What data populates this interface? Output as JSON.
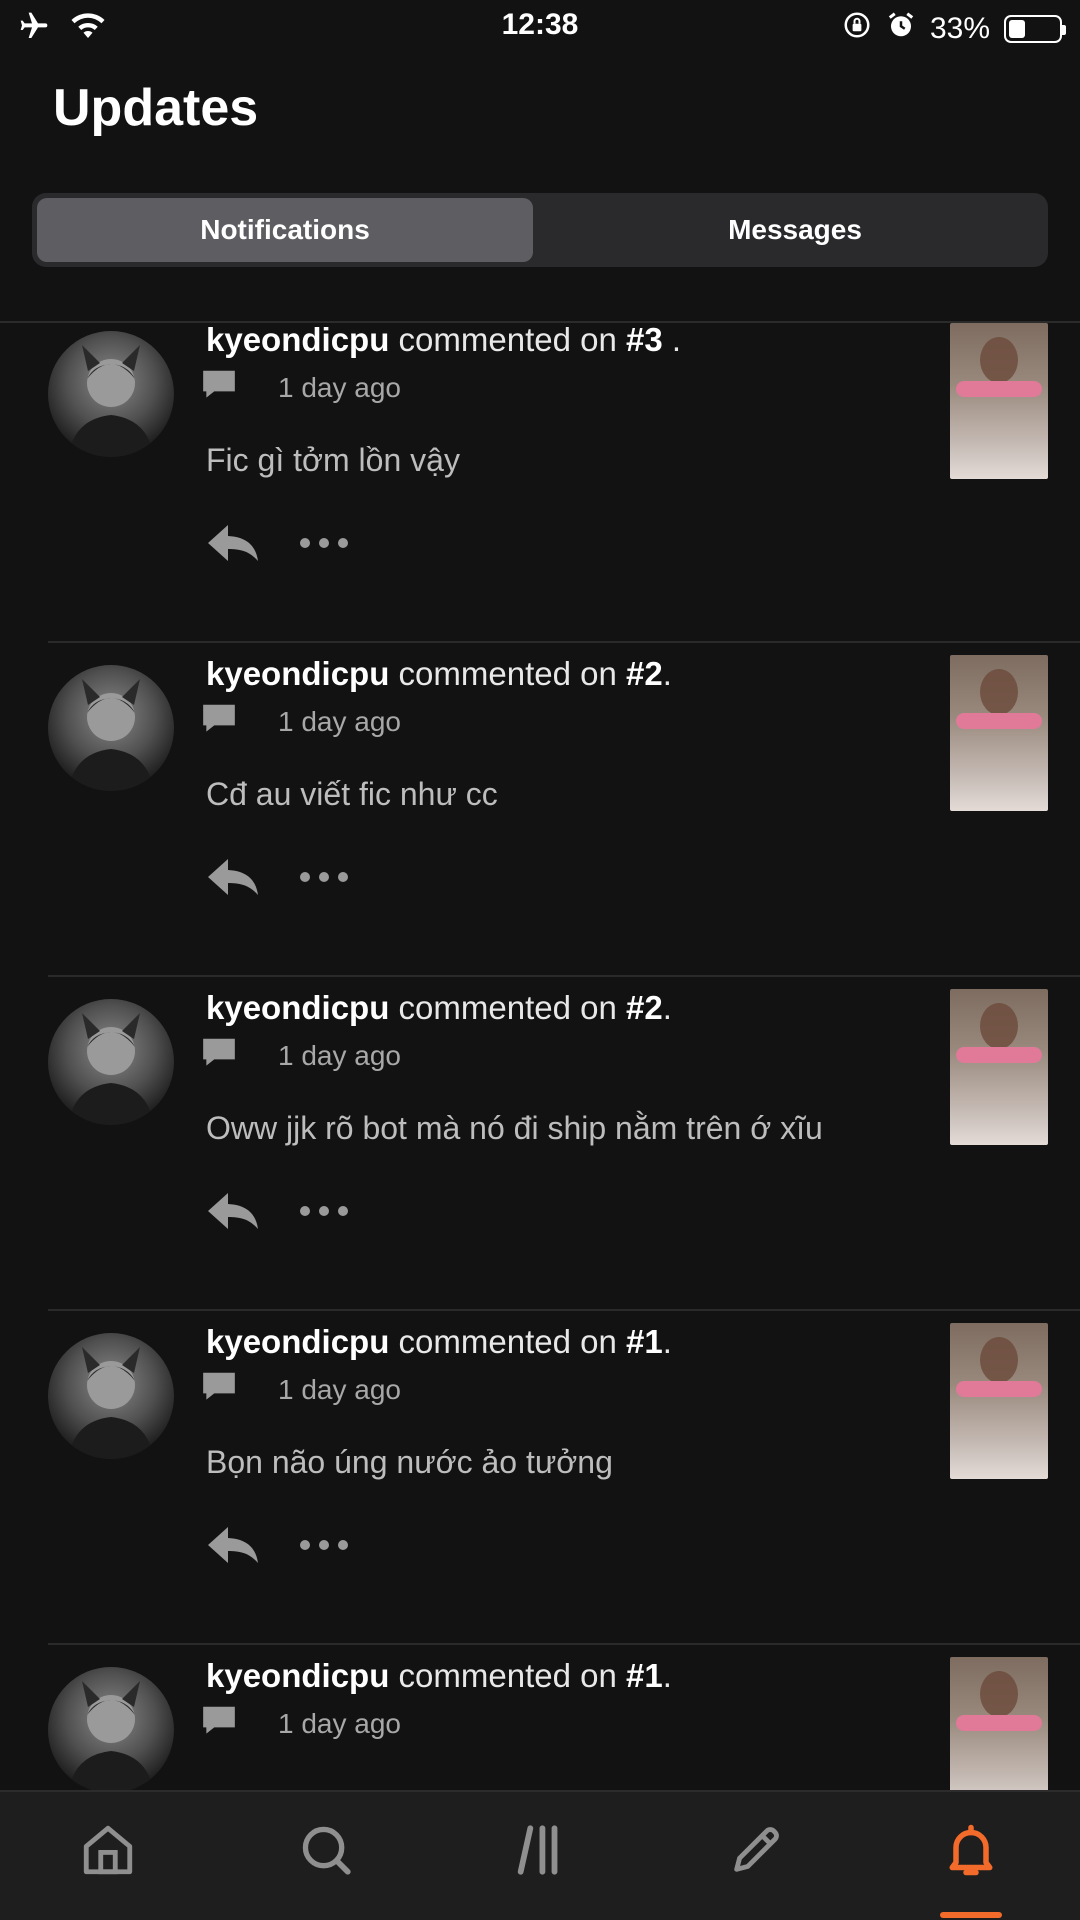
{
  "status_bar": {
    "time": "12:38",
    "battery": "33%",
    "battery_level": 0.33,
    "icons": [
      "airplane-icon",
      "wifi-icon",
      "orientation-lock-icon",
      "alarm-icon",
      "battery-icon"
    ]
  },
  "header": {
    "title": "Updates"
  },
  "tabs": [
    {
      "label": "Notifications",
      "active": true
    },
    {
      "label": "Messages",
      "active": false
    }
  ],
  "notifications": [
    {
      "user": "kyeondicpu",
      "action": "commented on",
      "part": "#3",
      "suffix": " .",
      "time": "1 day ago",
      "comment": "Fic gì tởm lồn vậy"
    },
    {
      "user": "kyeondicpu",
      "action": "commented on",
      "part": "#2",
      "suffix": ".",
      "time": "1 day ago",
      "comment": "Cđ au viết fic như cc"
    },
    {
      "user": "kyeondicpu",
      "action": "commented on",
      "part": "#2",
      "suffix": ".",
      "time": "1 day ago",
      "comment": "Oww jjk rõ bot mà nó đi ship nằm trên ớ xĩu"
    },
    {
      "user": "kyeondicpu",
      "action": "commented on",
      "part": "#1",
      "suffix": ".",
      "time": "1 day ago",
      "comment": "Bọn não úng nước ảo tưởng"
    },
    {
      "user": "kyeondicpu",
      "action": "commented on",
      "part": "#1",
      "suffix": ".",
      "time": "1 day ago",
      "comment": ""
    }
  ],
  "bottom_nav": [
    {
      "icon": "home-icon",
      "active": false
    },
    {
      "icon": "search-icon",
      "active": false
    },
    {
      "icon": "library-icon",
      "active": false
    },
    {
      "icon": "write-icon",
      "active": false
    },
    {
      "icon": "notifications-bell-icon",
      "active": true
    }
  ],
  "colors": {
    "background": "#121212",
    "accent": "#f26b2b",
    "tab_active": "#5e5e62"
  }
}
